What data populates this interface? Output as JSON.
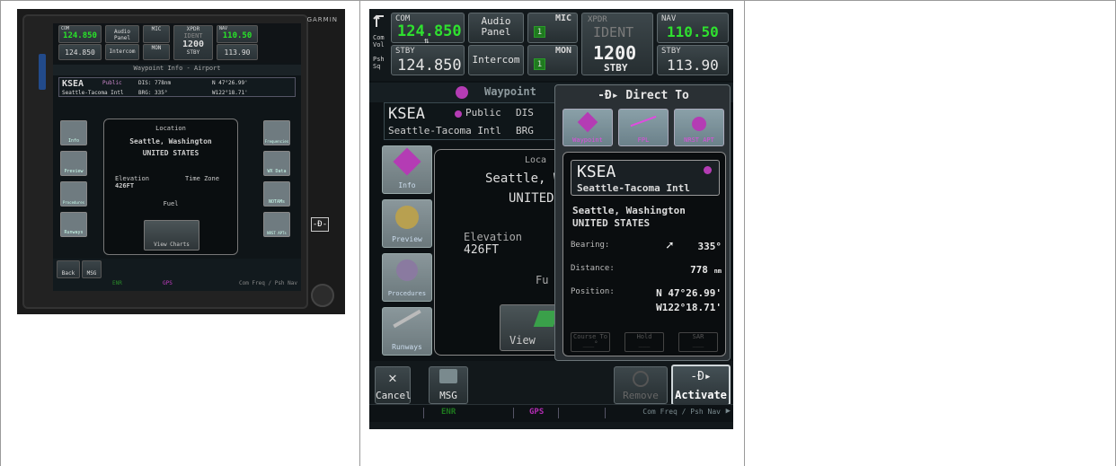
{
  "left_shot": {
    "brand": "GARMIN",
    "com_label": "COM",
    "com_active": "124.850",
    "com_standby_label": "STBY",
    "com_standby": "124.850",
    "audio_panel": "Audio Panel",
    "intercom": "Intercom",
    "mic": "MIC",
    "mon": "MON",
    "xpdr": "XPDR",
    "ident": "IDENT",
    "squawk": "1200",
    "stby": "STBY",
    "nav": "NAV",
    "nav_active": "110.50",
    "nav_standby": "113.90",
    "title": "Waypoint Info - Airport",
    "ident_code": "KSEA",
    "public": "Public",
    "airport_name": "Seattle-Tacoma Intl",
    "dis": "DIS: 778nm",
    "brg": "BRG: 335°",
    "lat": "N 47°26.99'",
    "lon": "W122°18.71'",
    "location_label": "Location",
    "city": "Seattle, Washington",
    "country": "UNITED STATES",
    "elevation_label": "Elevation",
    "elevation": "426FT",
    "timezone_label": "Time Zone",
    "fuel_label": "Fuel",
    "view_charts": "View Charts",
    "info": "Info",
    "preview": "Preview",
    "procedures": "Procedures",
    "runways": "Runways",
    "frequencies": "Frequencies",
    "wx_data": "WX Data",
    "notams": "NOTAMs",
    "nrst": "NRST APTs",
    "back": "Back",
    "msg": "MSG",
    "enr": "ENR",
    "gps": "GPS",
    "com_freq": "Com Freq / Psh Nav"
  },
  "right_shot": {
    "com_label": "COM",
    "com_active": "124.850",
    "com_standby_label": "STBY",
    "com_standby": "124.850",
    "com_vol": "Com Vol",
    "psh_sq": "Psh Sq",
    "audio_panel": "Audio Panel",
    "intercom": "Intercom",
    "mic": "MIC",
    "mon": "MON",
    "mic_box": "1",
    "mon_box": "1",
    "xpdr": "XPDR",
    "ident": "IDENT",
    "squawk": "1200",
    "stby": "STBY",
    "nav": "NAV",
    "nav_active": "110.50",
    "nav_standby_label": "STBY",
    "nav_standby": "113.90",
    "wpt_title": "Waypoint",
    "ident_code": "KSEA",
    "public": "Public",
    "dis_cut": "DIS",
    "airport_name": "Seattle-Tacoma Intl",
    "brg_cut": "BRG",
    "info": "Info",
    "preview": "Preview",
    "procedures": "Procedures",
    "runways": "Runways",
    "loc_cut": "Loca",
    "city_cut": "Seattle, W",
    "country_cut": "UNITED",
    "elevation_label": "Elevation",
    "elevation": "426FT",
    "fuel_cut": "Fu",
    "view_cut": "View",
    "direct_to": {
      "title": "Direct To",
      "tabs": [
        "Waypoint",
        "FPL",
        "NRST APT"
      ],
      "ident": "KSEA",
      "name": "Seattle-Tacoma Intl",
      "city": "Seattle, Washington",
      "country": "UNITED STATES",
      "bearing_label": "Bearing:",
      "bearing": "335°",
      "distance_label": "Distance:",
      "distance": "778",
      "distance_unit": "nm",
      "position_label": "Position:",
      "lat": "N 47°26.99'",
      "lon": "W122°18.71'",
      "course_to": "Course To",
      "hold": "Hold",
      "sar": "SAR",
      "course_value": "___°",
      "hold_value": "___",
      "sar_value": "___"
    },
    "cancel": "Cancel",
    "msg": "MSG",
    "remove": "Remove",
    "activate": "Activate",
    "enr": "ENR",
    "gps": "GPS",
    "com_freq": "Com Freq / Psh Nav"
  }
}
